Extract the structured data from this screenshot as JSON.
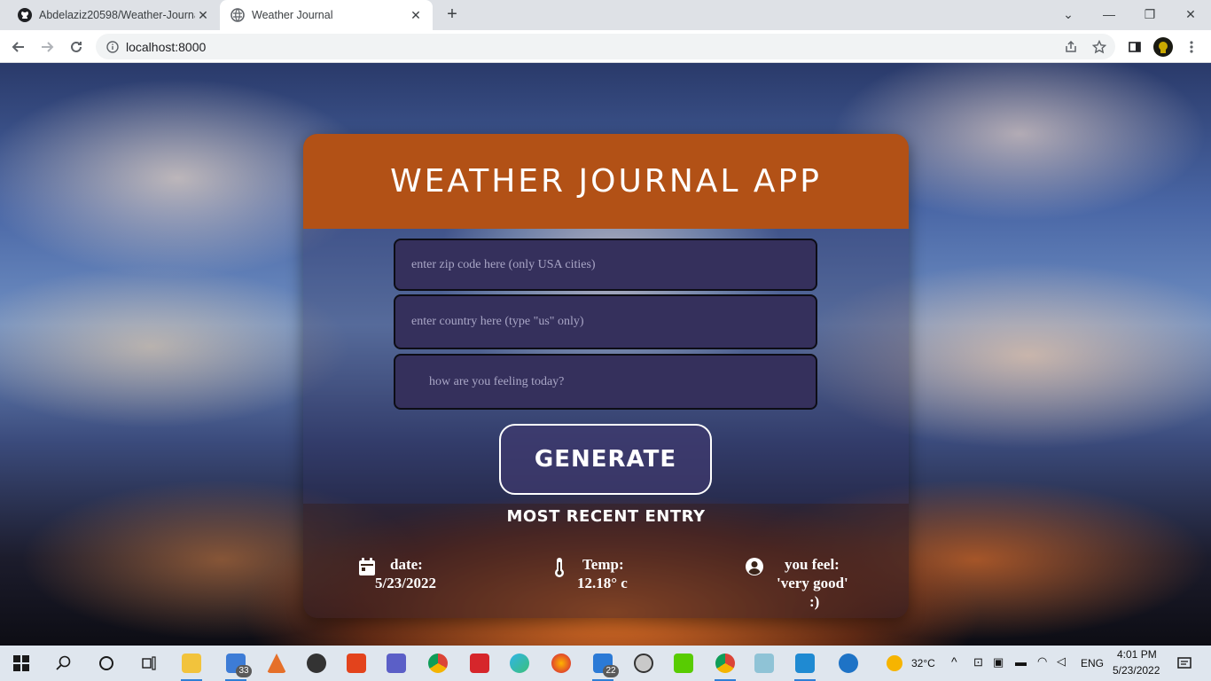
{
  "browser": {
    "tabs": [
      {
        "title": "Abdelaziz20598/Weather-Journal",
        "active": false
      },
      {
        "title": "Weather Journal",
        "active": true
      }
    ],
    "new_tab": "+",
    "url": "localhost:8000"
  },
  "app": {
    "title": "WEATHER JOURNAL APP",
    "zip_placeholder": "enter zip code here (only USA cities)",
    "country_placeholder": "enter country here (type \"us\" only)",
    "feelings_placeholder": "how are you feeling today?",
    "generate_label": "GENERATE",
    "entry_title": "MOST RECENT ENTRY",
    "date_label": "date:",
    "date_value": "5/23/2022",
    "temp_label": "Temp:",
    "temp_value": "12.18° c",
    "feel_label": "you feel:",
    "feel_value": "'very good'",
    "feel_suffix": ":)"
  },
  "taskbar": {
    "mail_badge": "33",
    "folder_badge": "22",
    "weather_temp": "32°C",
    "language": "ENG",
    "time": "4:01 PM",
    "date": "5/23/2022"
  },
  "colors": {
    "header": "#b25116",
    "input_bg": "#35305c",
    "taskbar": "#dfe6ee"
  }
}
